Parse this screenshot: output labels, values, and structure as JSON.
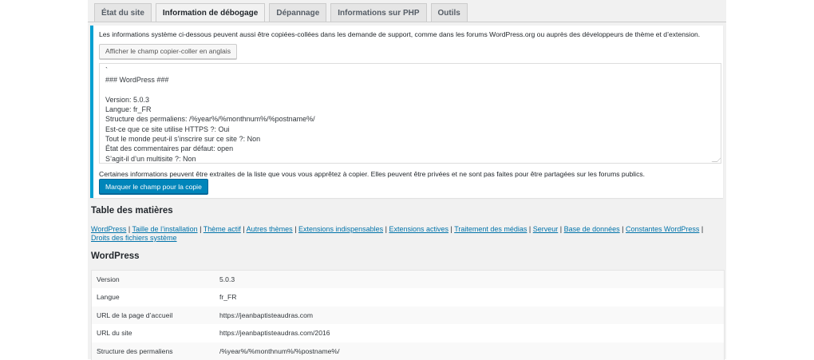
{
  "tabs": [
    {
      "label": "État du site",
      "active": false
    },
    {
      "label": "Information de débogage",
      "active": true
    },
    {
      "label": "Dépannage",
      "active": false
    },
    {
      "label": "Informations sur PHP",
      "active": false
    },
    {
      "label": "Outils",
      "active": false
    }
  ],
  "notice": {
    "intro": "Les informations système ci-dessous peuvent aussi être copiées-collées dans les demande de support, comme dans les forums WordPress.org ou auprès des développeurs de thème et d’extension.",
    "english_button": "Afficher le champ copier-coller en anglais",
    "textarea_lines": [
      "`",
      "### WordPress ###",
      "",
      "Version: 5.0.3",
      "Langue: fr_FR",
      "Structure des permaliens: /%year%/%monthnum%/%postname%/",
      "Est-ce que ce site utilise HTTPS ?: Oui",
      "Tout le monde peut-il s’inscrire sur ce site ?: Non",
      "État des commentaires par défaut: open",
      "S’agit-il d’un multisite ?: Non"
    ],
    "warning": "Certaines informations peuvent être extraites de la liste que vous vous apprêtez à copier. Elles peuvent être privées et ne sont pas faites pour être partagées sur les forums publics.",
    "copy_button": "Marquer le champ pour la copie"
  },
  "toc": {
    "title": "Table des matières",
    "links": [
      "WordPress",
      "Taille de l’installation",
      "Thème actif",
      "Autres thèmes",
      "Extensions indispensables",
      "Extensions actives",
      "Traitement des médias",
      "Serveur",
      "Base de données",
      "Constantes WordPress",
      "Droits des fichiers système"
    ],
    "separator": " | "
  },
  "section": {
    "title": "WordPress",
    "rows": [
      {
        "key": "Version",
        "value": "5.0.3"
      },
      {
        "key": "Langue",
        "value": "fr_FR"
      },
      {
        "key": "URL de la page d’accueil",
        "value": "https://jeanbaptisteaudras.com"
      },
      {
        "key": "URL du site",
        "value": "https://jeanbaptisteaudras.com/2016"
      },
      {
        "key": "Structure des permaliens",
        "value": "/%year%/%monthnum%/%postname%/"
      }
    ]
  },
  "colors": {
    "accent": "#00a0d2",
    "primary_button": "#0085ba",
    "link": "#0073aa"
  }
}
